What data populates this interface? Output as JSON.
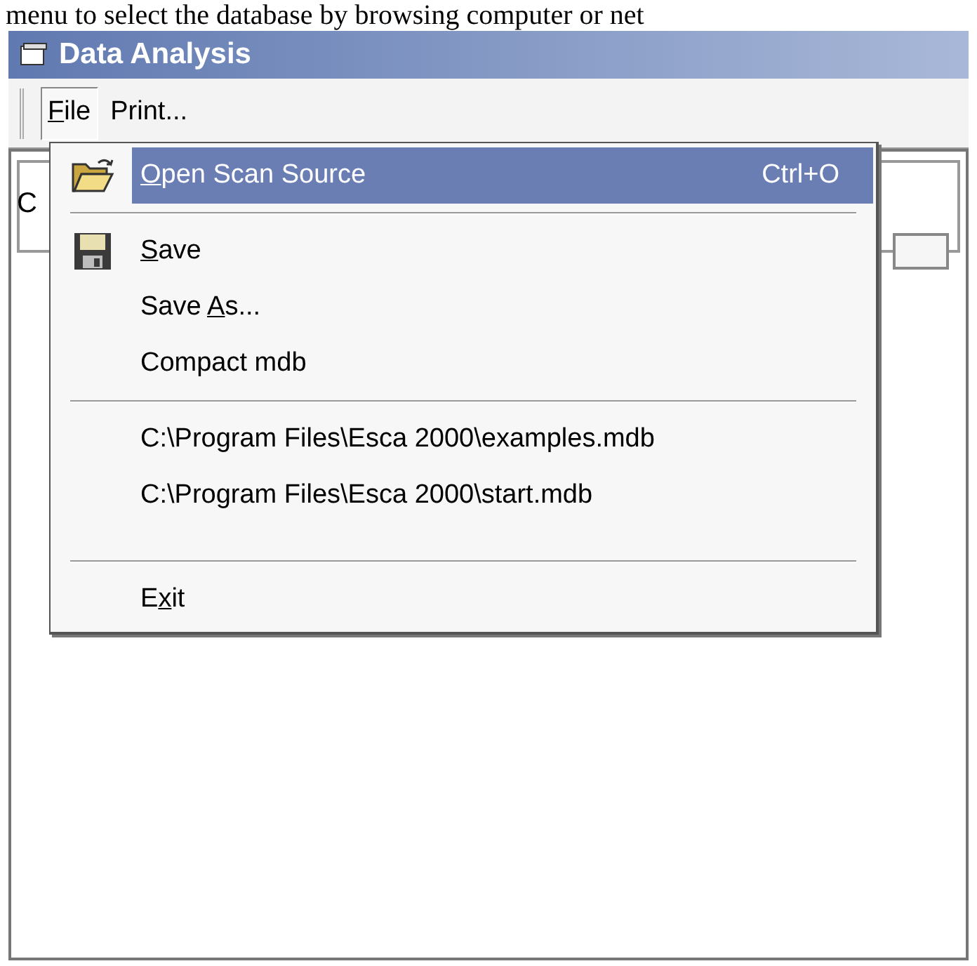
{
  "caption": "menu to select the database by browsing computer or net",
  "window": {
    "title": "Data Analysis"
  },
  "menubar": [
    {
      "key": "F",
      "post": "ile",
      "selected": true
    },
    {
      "pre": "Print...",
      "selected": false
    }
  ],
  "background": {
    "label": "C"
  },
  "menu": [
    {
      "kind": "folder",
      "key": "O",
      "post": "pen Scan Source",
      "shortcut": "Ctrl+O",
      "selected": true
    },
    {
      "kind": "separator"
    },
    {
      "kind": "disk",
      "key": "S",
      "post": "ave",
      "selected": false
    },
    {
      "kind": "plain",
      "pre": "Save ",
      "key": "A",
      "post": "s...",
      "selected": false
    },
    {
      "kind": "plain",
      "pre": "Compact mdb",
      "selected": false
    },
    {
      "kind": "separator"
    },
    {
      "kind": "plain",
      "pre": "C:\\Program Files\\Esca 2000\\examples.mdb",
      "selected": false
    },
    {
      "kind": "plain",
      "pre": "C:\\Program Files\\Esca 2000\\start.mdb",
      "selected": false
    },
    {
      "kind": "gap"
    },
    {
      "kind": "separator"
    },
    {
      "kind": "plain",
      "pre": "E",
      "key": "x",
      "post": "it",
      "selected": false
    }
  ]
}
